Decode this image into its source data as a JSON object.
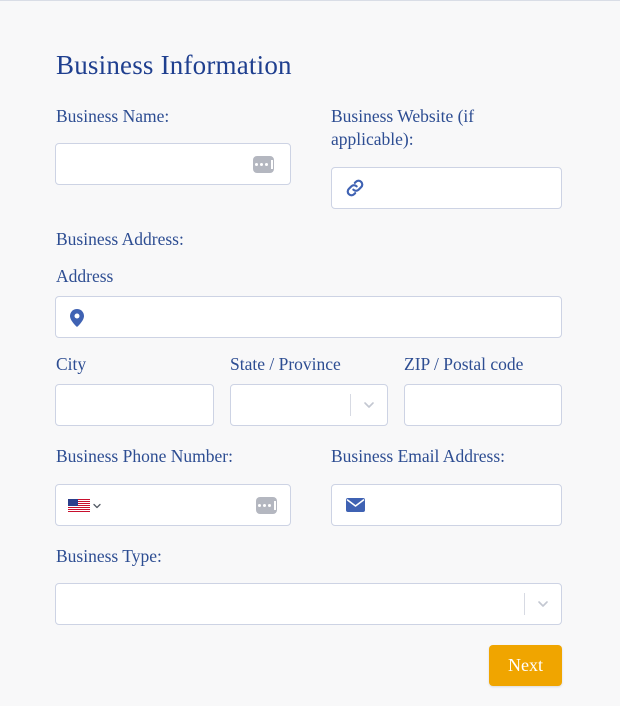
{
  "form": {
    "title": "Business Information",
    "business_name": {
      "label": "Business Name:",
      "value": "",
      "placeholder": ""
    },
    "business_website": {
      "label": "Business Website (if applicable):",
      "value": "",
      "placeholder": "",
      "icon": "link-icon"
    },
    "business_address": {
      "label": "Business Address:"
    },
    "address": {
      "label": "Address",
      "value": "",
      "placeholder": "",
      "icon": "map-pin-icon"
    },
    "city": {
      "label": "City",
      "value": ""
    },
    "state": {
      "label": "State / Province",
      "value": ""
    },
    "zip": {
      "label": "ZIP / Postal code",
      "value": ""
    },
    "phone": {
      "label": "Business Phone Number:",
      "value": "",
      "country_flag": "us-flag-icon"
    },
    "email": {
      "label": "Business Email Address:",
      "value": "",
      "icon": "envelope-icon"
    },
    "business_type": {
      "label": "Business Type:",
      "value": ""
    },
    "next_label": "Next"
  },
  "colors": {
    "accent": "#f0a500",
    "label": "#2d4d92",
    "icon": "#3f62b3",
    "border": "#cdd3e4"
  }
}
